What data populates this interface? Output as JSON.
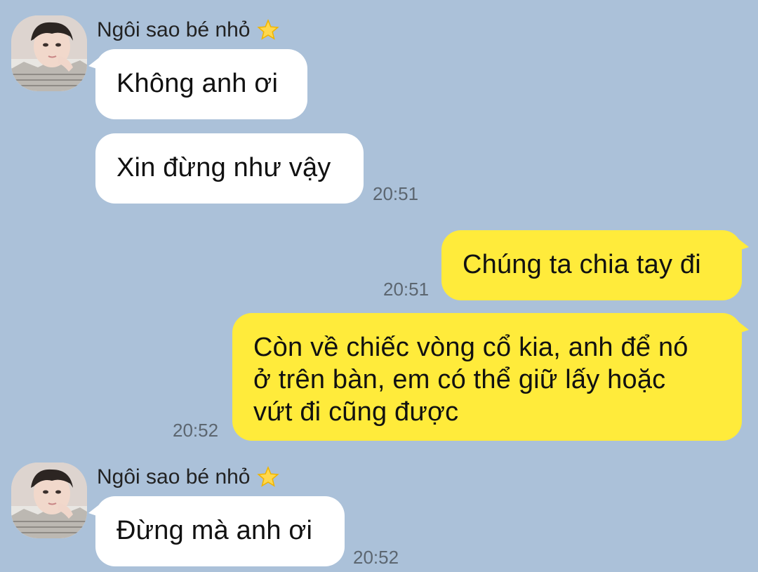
{
  "conversation": {
    "background": "#abc1d9",
    "incoming_bubble_color": "#ffffff",
    "outgoing_bubble_color": "#ffeb3b",
    "groups": [
      {
        "sender": "Ngôi sao bé nhỏ",
        "sender_icon": "star-icon",
        "messages": [
          {
            "text": "Không anh ơi"
          },
          {
            "text": "Xin đừng như vậy",
            "time": "20:51"
          }
        ]
      },
      {
        "direction": "outgoing",
        "messages": [
          {
            "text": "Chúng ta chia tay đi",
            "time": "20:51"
          },
          {
            "lines": [
              "Còn về chiếc vòng cổ kia, anh để nó",
              "ở trên bàn, em có thể giữ lấy hoặc",
              "vứt đi cũng được"
            ],
            "time": "20:52"
          }
        ]
      },
      {
        "sender": "Ngôi sao bé nhỏ",
        "sender_icon": "star-icon",
        "messages": [
          {
            "text": "Đừng mà anh ơi",
            "time": "20:52"
          }
        ]
      }
    ]
  }
}
